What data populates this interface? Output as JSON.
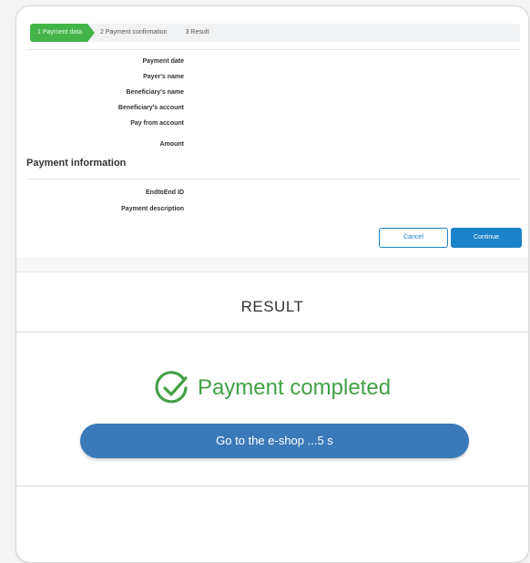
{
  "steps": {
    "step1": "1  Payment data",
    "step2": "2  Payment confirmation",
    "step3": "3  Result"
  },
  "form": {
    "labels": [
      "Payment date",
      "Payer's name",
      "Beneficiary's name",
      "Beneficiary's account",
      "Pay from account",
      "Amount"
    ],
    "section_title": "Payment information",
    "info_labels": [
      "EndtoEnd ID",
      "Payment description"
    ]
  },
  "buttons": {
    "cancel": "Cancel",
    "continue": "Continue"
  },
  "result": {
    "title": "RESULT",
    "completed": "Payment completed",
    "shop_button": "Go to the e-shop ...5 s"
  },
  "colors": {
    "active_step": "#43b548",
    "primary": "#1a83c9",
    "success": "#43a047",
    "shop_button": "#3a7ab9"
  }
}
